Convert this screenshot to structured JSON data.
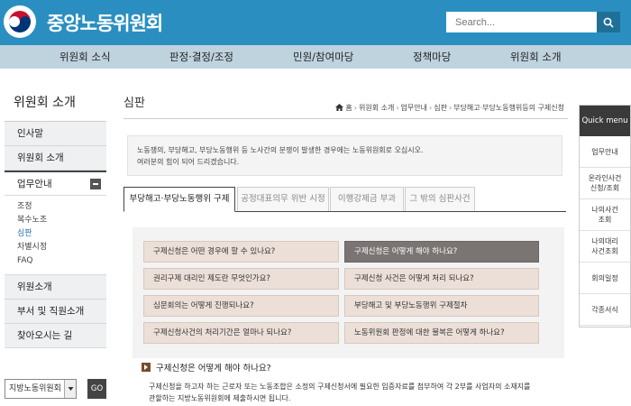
{
  "header": {
    "site_title": "중앙노동위원회",
    "search_placeholder": "Search...",
    "brand_color": "#2a8fc0"
  },
  "gnb": {
    "items": [
      "위원회 소식",
      "판정·결정/조정",
      "민원/참여마당",
      "정책마당",
      "위원회 소개"
    ]
  },
  "sidebar": {
    "title": "위원회 소개",
    "items": [
      "인사말",
      "위원회 소개",
      "업무안내"
    ],
    "sub_items": [
      "조정",
      "복수노조",
      "심판",
      "차별시정",
      "FAQ"
    ],
    "items_after": [
      "위원소개",
      "부서 및 직원소개",
      "찾아오시는 길"
    ],
    "select_value": "지방노동위원회",
    "go_label": "GO"
  },
  "main": {
    "page_title": "심판",
    "breadcrumb": [
      "홈",
      "위원회 소개",
      "업무안내",
      "심판",
      "부당해고·부당노동행위등의 구제신청"
    ],
    "intro": [
      "노동쟁의, 부당해고, 부당노동행위 등 노사간의 분쟁이 발생한 경우에는 노동위원회로 오십시오.",
      "여러분의 힘이 되어 드리겠습니다."
    ],
    "tabs": [
      "부당해고·부당노동행위 구제",
      "공정대표의무 위반 시정",
      "이행강제금 부과",
      "그 밖의 심판사건"
    ],
    "faq": [
      "구제신청은 어떤 경우에 할 수 있나요?",
      "구제신청은 어떻게 해야 하나요?",
      "권리구제 대리인 제도란 무엇인가요?",
      "구제신청 사건은 어떻게 처리 되나요?",
      "심문회의는 어떻게 진행되나요?",
      "부당해고 및 부당노동행위 구제절차",
      "구제신청사건의 처리기간은 얼마나 되나요?",
      "노동위원회 판정에 대한 불복은 어떻게 하나요?"
    ],
    "question": "구제신청은 어떻게 해야 하나요?",
    "answer": [
      "구제신청을 하고자 하는 근로자 또는 노동조합은 소정의 구제신청서에 필요한 입증자료를 첨부하여 각 2부를 사업자의 소재지를",
      "관할하는 지방노동위원회에 제출하시면 됩니다."
    ]
  },
  "quick_menu": {
    "title": "Quick menu",
    "items": [
      "업무안내",
      "온라인사건\n신청/조회",
      "나의사건\n조회",
      "나의대리\n사건조회",
      "회의일정",
      "각종서식"
    ]
  }
}
